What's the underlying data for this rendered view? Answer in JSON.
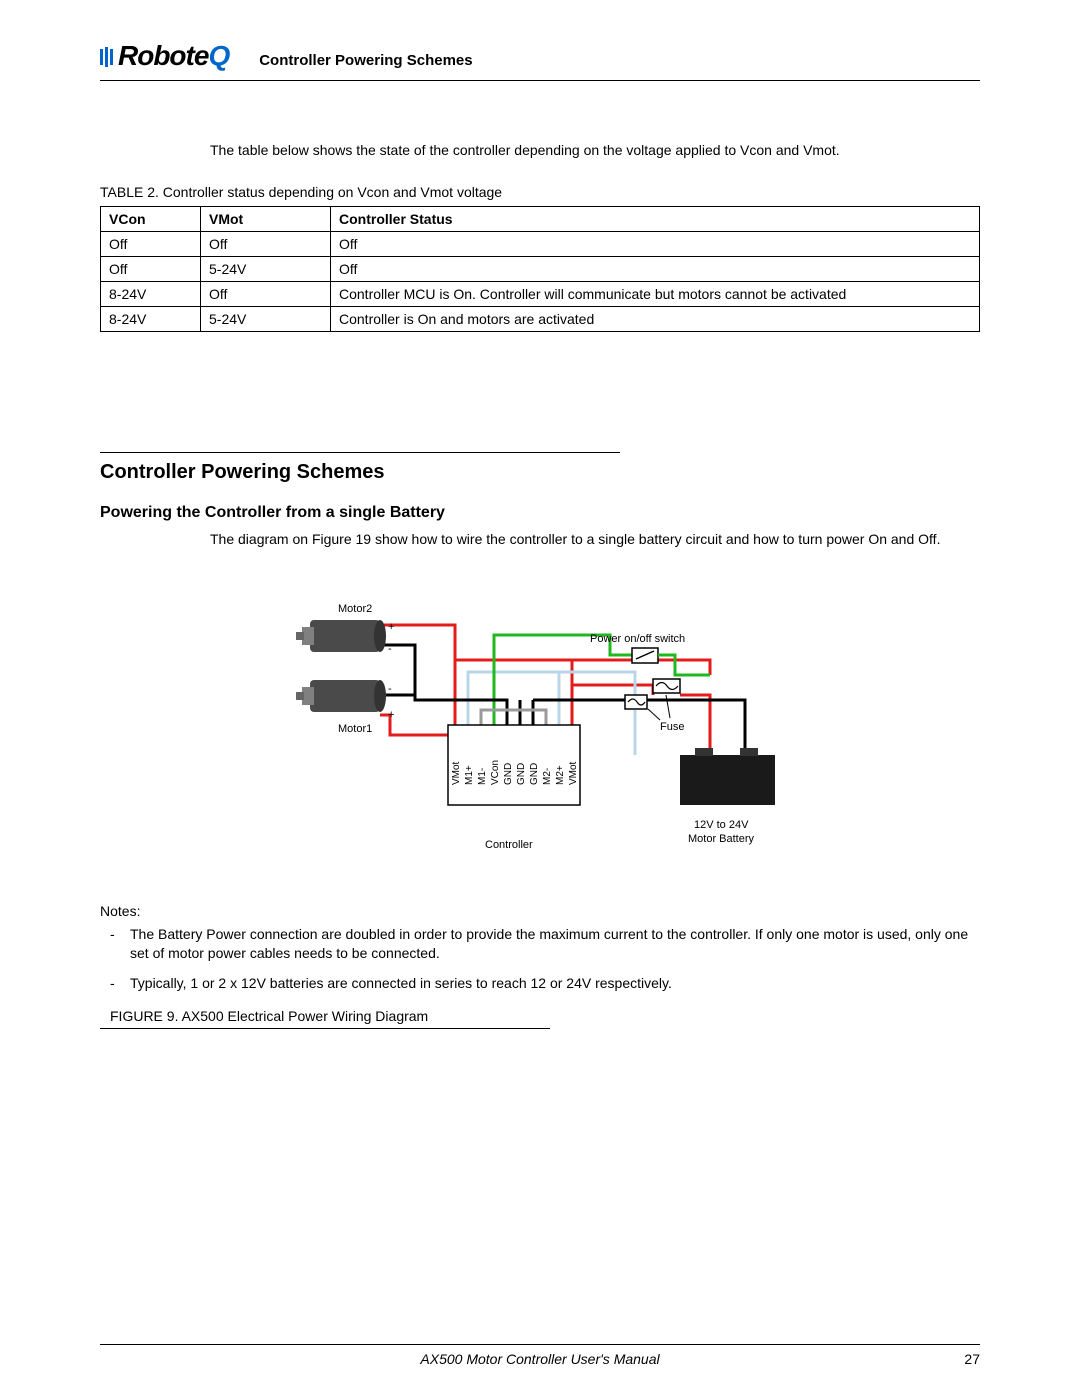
{
  "header": {
    "logo_text": "Robote",
    "logo_q": "Q",
    "title": "Controller Powering Schemes"
  },
  "intro": "The table below shows the state of the controller depending on the voltage applied to Vcon and Vmot.",
  "table": {
    "caption": "TABLE 2. Controller status depending on Vcon and Vmot voltage",
    "headers": {
      "c0": "VCon",
      "c1": "VMot",
      "c2": "Controller Status"
    },
    "rows": [
      {
        "c0": "Off",
        "c1": "Off",
        "c2": "Off"
      },
      {
        "c0": "Off",
        "c1": "5-24V",
        "c2": "Off"
      },
      {
        "c0": "8-24V",
        "c1": "Off",
        "c2": "Controller MCU is On. Controller will communicate but motors cannot be activated"
      },
      {
        "c0": "8-24V",
        "c1": "5-24V",
        "c2": "Controller is On and motors are activated"
      }
    ]
  },
  "section": {
    "heading": "Controller Powering Schemes",
    "sub_heading": "Powering the Controller from a single Battery",
    "body": "The diagram on Figure 19 show how to wire the controller to a single battery circuit and how to turn power On and Off."
  },
  "diagram": {
    "labels": {
      "motor2": "Motor2",
      "motor1": "Motor1",
      "plus_top": "+",
      "minus_top": "-",
      "plus_bot": "+",
      "minus_bot": "-",
      "switch": "Power on/off switch",
      "fuse": "Fuse",
      "controller": "Controller",
      "battery": "12V to 24V\nMotor Battery",
      "pins": [
        "VMot",
        "M1+",
        "M1-",
        "VCon",
        "GND",
        "GND",
        "GND",
        "M2-",
        "M2+",
        "VMot"
      ]
    }
  },
  "notes": {
    "label": "Notes:",
    "items": [
      "The Battery Power connection are doubled in order to provide the maximum current to the controller. If only one motor is used, only one set of motor power cables needs to be connected.",
      "Typically, 1 or 2 x 12V batteries are connected in series to reach 12 or 24V respectively."
    ]
  },
  "figure_caption": "FIGURE 9.  AX500 Electrical Power Wiring Diagram",
  "footer": {
    "title": "AX500 Motor Controller User's Manual",
    "page": "27"
  },
  "chart_data": {
    "type": "table",
    "title": "Controller status depending on Vcon and Vmot voltage",
    "columns": [
      "VCon",
      "VMot",
      "Controller Status"
    ],
    "rows": [
      [
        "Off",
        "Off",
        "Off"
      ],
      [
        "Off",
        "5-24V",
        "Off"
      ],
      [
        "8-24V",
        "Off",
        "Controller MCU is On. Controller will communicate but motors cannot be activated"
      ],
      [
        "8-24V",
        "5-24V",
        "Controller is On and motors are activated"
      ]
    ]
  }
}
